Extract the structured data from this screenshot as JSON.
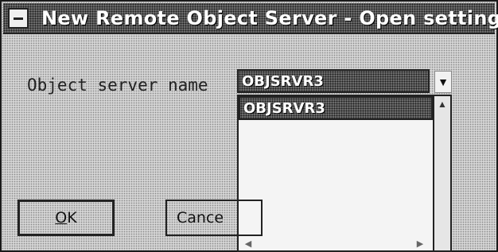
{
  "window": {
    "title": "New Remote Object Server - Open settings",
    "system_menu_icon": "system-menu-icon"
  },
  "form": {
    "server_name_label": "Object server name",
    "server_name_value": "OBJSRVR3"
  },
  "dropdown": {
    "options": [
      "OBJSRVR3"
    ],
    "selected": "OBJSRVR3",
    "toggle_icon": "chevron-down-icon",
    "scroll_up_icon": "arrow-up-icon",
    "scroll_left_icon": "arrow-left-icon",
    "scroll_right_icon": "arrow-right-icon"
  },
  "buttons": {
    "ok_mnemonic": "O",
    "ok_rest": "K",
    "cancel_label": "Cance"
  }
}
